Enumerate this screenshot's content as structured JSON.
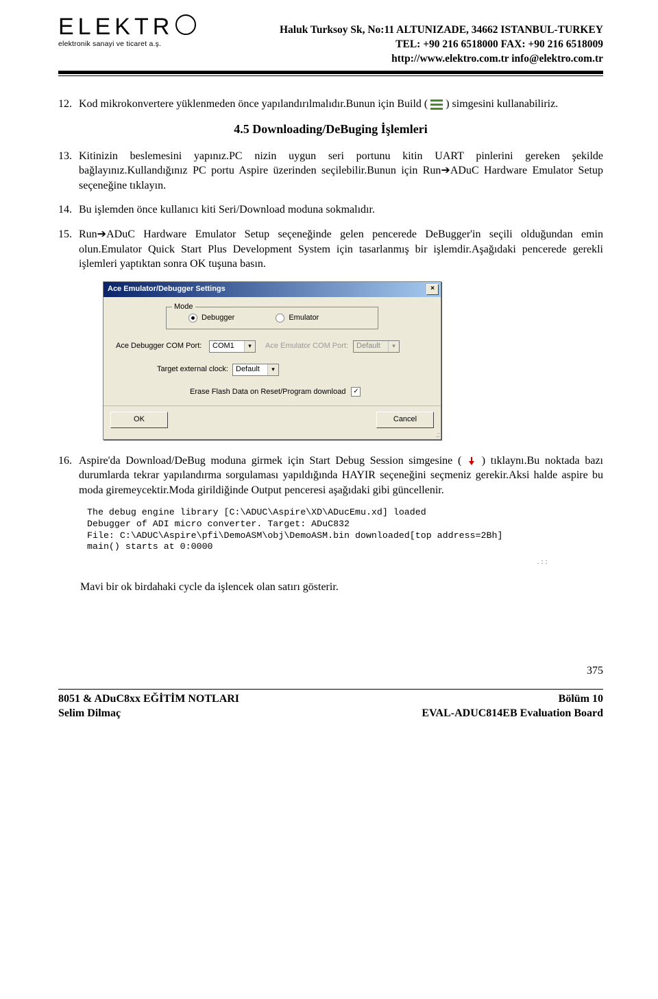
{
  "header": {
    "logo_letters": "ELEKTR",
    "logo_sub": "elektronik sanayi ve ticaret a.ş.",
    "addr_line1": "Haluk Turksoy Sk, No:11 ALTUNIZADE, 34662  ISTANBUL-TURKEY",
    "addr_line2": "TEL: +90 216 6518000    FAX: +90 216 6518009",
    "addr_line3": "http://www.elektro.com.tr    info@elektro.com.tr"
  },
  "items": {
    "n12": "12.",
    "t12a": "Kod mikrokonvertere yüklenmeden önce yapılandırılmalıdır.Bunun için Build (",
    "t12b": " ) simgesini kullanabiliriz.",
    "sect45": "4.5 Downloading/DeBuging İşlemleri",
    "n13": "13.",
    "t13": "Kitinizin beslemesini yapınız.PC nizin uygun seri portunu kitin UART pinlerini gereken şekilde bağlayınız.Kullandığınız PC portu Aspire üzerinden seçilebilir.Bunun için Run➔ADuC Hardware Emulator Setup seçeneğine tıklayın.",
    "n14": "14.",
    "t14": "Bu işlemden önce kullanıcı kiti Seri/Download moduna sokmalıdır.",
    "n15": "15.",
    "t15": "Run➔ADuC Hardware Emulator Setup seçeneğinde gelen pencerede DeBugger'in seçili olduğundan emin olun.Emulator Quick Start Plus Development System için tasarlanmış bir işlemdir.Aşağıdaki pencerede gerekli işlemleri yaptıktan sonra OK tuşuna basın.",
    "n16": "16.",
    "t16": "Aspire'da Download/DeBug moduna girmek için Start Debug Session simgesine (",
    "t16b": ") tıklaynı.Bu noktada bazı durumlarda tekrar yapılandırma sorgulaması yapıldığında HAYIR seçeneğini seçmeniz gerekir.Aksi halde aspire bu moda giremeycektir.Moda girildiğinde Output penceresi aşağıdaki gibi güncellenir."
  },
  "dialog": {
    "title": "Ace Emulator/Debugger Settings",
    "close": "×",
    "mode_legend": "Mode",
    "mode_debugger": "Debugger",
    "mode_emulator": "Emulator",
    "dbg_port_lbl": "Ace Debugger COM Port:",
    "dbg_port_val": "COM1",
    "emu_port_lbl": "Ace Emulator COM Port:",
    "emu_port_val": "Default",
    "clk_lbl": "Target external clock:",
    "clk_val": "Default",
    "erase_lbl": "Erase Flash Data on Reset/Program download",
    "erase_check": "✓",
    "ok": "OK",
    "cancel": "Cancel",
    "dropdown_mark": "▾"
  },
  "console": {
    "l1": "The debug engine library [C:\\ADUC\\Aspire\\XD\\ADucEmu.xd] loaded",
    "l2": "Debugger of ADI micro converter. Target: ADuC832",
    "l3": "File: C:\\ADUC\\Aspire\\pfi\\DemoASM\\obj\\DemoASM.bin downloaded[top address=2Bh]",
    "l4": "main() starts at 0:0000"
  },
  "post_console": "Mavi bir ok birdahaki cycle da işlencek olan satırı gösterir.",
  "page_number": "375",
  "footer": {
    "l1_left": "8051 & ADuC8xx EĞİTİM NOTLARI",
    "l1_right": "Bölüm 10",
    "l2_left": "Selim Dilmaç",
    "l2_right": "EVAL-ADUC814EB Evaluation Board"
  }
}
